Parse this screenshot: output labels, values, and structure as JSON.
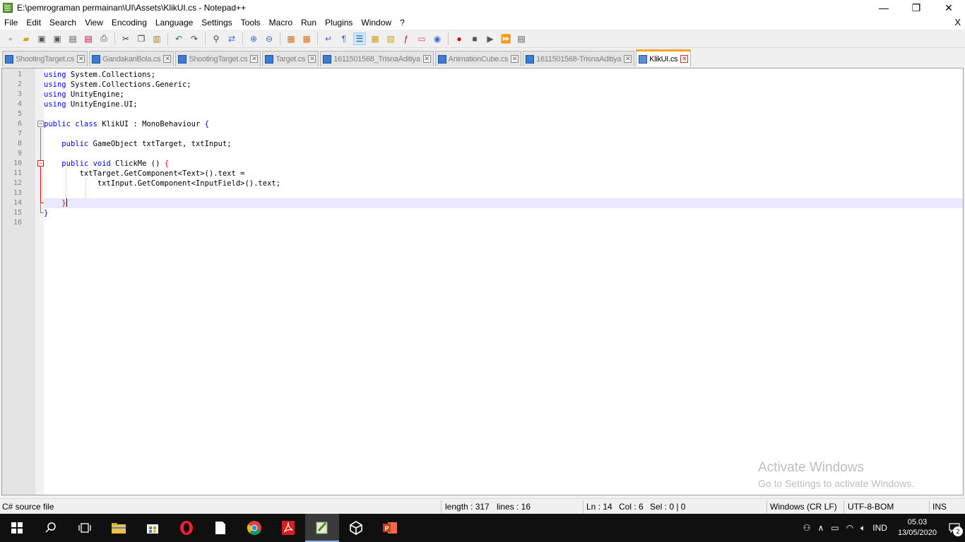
{
  "window": {
    "title": "E:\\pemrograman permainan\\UI\\Assets\\KlikUI.cs - Notepad++",
    "minimize": "—",
    "restore": "❐",
    "close": "✕"
  },
  "menu": {
    "items": [
      "File",
      "Edit",
      "Search",
      "View",
      "Encoding",
      "Language",
      "Settings",
      "Tools",
      "Macro",
      "Run",
      "Plugins",
      "Window",
      "?"
    ],
    "close_doc": "X"
  },
  "toolbar": {
    "icons": [
      "new-file-icon",
      "open-file-icon",
      "save-icon",
      "save-all-icon",
      "close-icon",
      "close-all-icon",
      "print-icon",
      "cut-icon",
      "copy-icon",
      "paste-icon",
      "undo-icon",
      "redo-icon",
      "find-icon",
      "replace-icon",
      "zoom-in-icon",
      "zoom-out-icon",
      "sync-vertical-icon",
      "sync-horizontal-icon",
      "word-wrap-icon",
      "show-all-chars-icon",
      "indent-guide-icon",
      "udl-icon",
      "doc-map-icon",
      "function-list-icon",
      "folder-workspace-icon",
      "monitoring-icon",
      "record-macro-icon",
      "stop-macro-icon",
      "play-macro-icon",
      "run-macro-multiple-icon",
      "save-macro-icon"
    ]
  },
  "tabs": [
    {
      "label": "ShootingTarget.cs",
      "active": false
    },
    {
      "label": "GandakanBola.cs",
      "active": false
    },
    {
      "label": "ShootingTarget.cs",
      "active": false
    },
    {
      "label": "Target.cs",
      "active": false
    },
    {
      "label": "1611501568_TrisnaAditiya",
      "active": false
    },
    {
      "label": "AnimationCube.cs",
      "active": false
    },
    {
      "label": "1611501568-TrisnaAditiya",
      "active": false
    },
    {
      "label": "KlikUI.cs",
      "active": true
    }
  ],
  "editor": {
    "line_numbers": [
      "1",
      "2",
      "3",
      "4",
      "5",
      "6",
      "7",
      "8",
      "9",
      "10",
      "11",
      "12",
      "13",
      "14",
      "15",
      "16"
    ],
    "current_line": 14
  },
  "watermark": {
    "line1": "Activate Windows",
    "line2": "Go to Settings to activate Windows."
  },
  "status": {
    "file_type": "C# source file",
    "length": "length : 317",
    "lines": "lines : 16",
    "ln": "Ln : 14",
    "col": "Col : 6",
    "sel": "Sel : 0 | 0",
    "eol": "Windows (CR LF)",
    "encoding": "UTF-8-BOM",
    "mode": "INS"
  },
  "taskbar": {
    "language": "IND",
    "time": "05.03",
    "date": "13/05/2020",
    "notifications": "2"
  }
}
